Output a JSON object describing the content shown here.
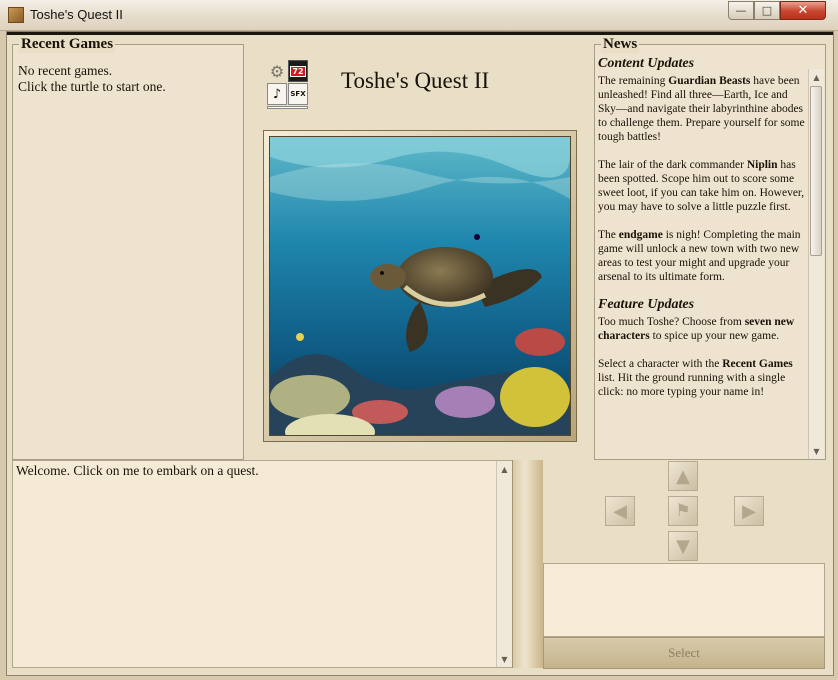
{
  "window": {
    "title": "Toshe's Quest II",
    "minimize_glyph": "—",
    "maximize_glyph": "□",
    "close_glyph": "✕"
  },
  "recent_games": {
    "legend": "Recent Games",
    "line1": "No recent games.",
    "line2": "Click the turtle to start one."
  },
  "settings": {
    "badge_text": "72",
    "music_glyph": "♪",
    "sfx_text": "SFX"
  },
  "game_title": "Toshe's Quest II",
  "news": {
    "legend": "News",
    "content_heading": "Content Updates",
    "p1": [
      {
        "t": "The remaining "
      },
      {
        "t": "Guardian Beasts",
        "b": true
      },
      {
        "t": " have been unleashed! Find all three—Earth, Ice and Sky—and navigate their labyrinthine abodes to challenge them. Prepare yourself for some tough battles!"
      }
    ],
    "p2": [
      {
        "t": "The lair of the dark commander "
      },
      {
        "t": "Niplin",
        "b": true
      },
      {
        "t": " has been spotted. Scope him out to score some sweet loot, if you can take him on. However, you may have to solve a little puzzle first."
      }
    ],
    "p3": [
      {
        "t": "The "
      },
      {
        "t": "endgame",
        "b": true
      },
      {
        "t": " is nigh! Completing the main game will unlock a new town with two new areas to test your might and upgrade your arsenal to its ultimate form."
      }
    ],
    "feature_heading": "Feature Updates",
    "p4": [
      {
        "t": "Too much Toshe? Choose from "
      },
      {
        "t": "seven new characters",
        "b": true
      },
      {
        "t": " to spice up your new game."
      }
    ],
    "p5": [
      {
        "t": "Select a character with the "
      },
      {
        "t": "Recent Games",
        "b": true
      },
      {
        "t": " list. Hit the ground running with a single click: no more typing your name in!"
      }
    ]
  },
  "log": {
    "text": "Welcome. Click on me to embark on a quest."
  },
  "navigation": {
    "north": "▲",
    "west": "◀",
    "center": "⚑",
    "east": "▶",
    "south": "▼"
  },
  "select_button": "Select",
  "scroll_glyphs": {
    "up": "▲",
    "down": "▼"
  }
}
